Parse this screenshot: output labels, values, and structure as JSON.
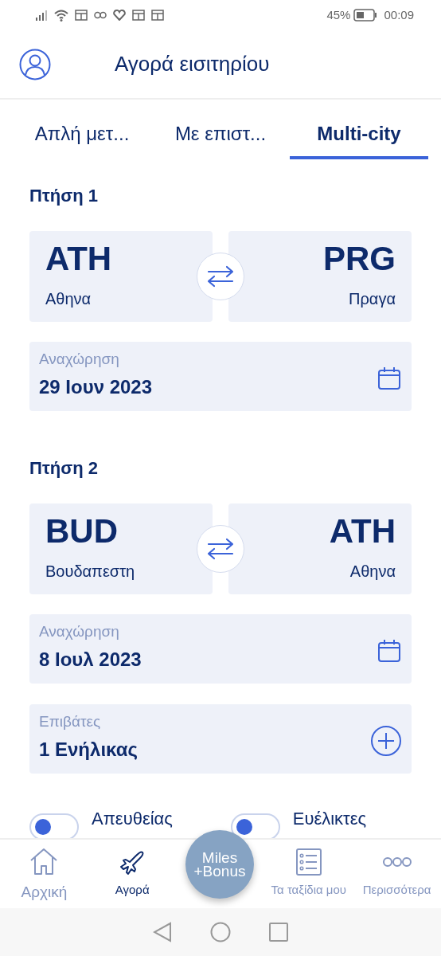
{
  "status_bar": {
    "battery": "45%",
    "time": "00:09"
  },
  "header": {
    "title": "Αγορά εισιτηρίου"
  },
  "tabs": [
    {
      "label": "Απλή μετ...",
      "selected": false
    },
    {
      "label": "Με επιστ...",
      "selected": false
    },
    {
      "label": "Multi-city",
      "selected": true
    }
  ],
  "flights": [
    {
      "title": "Πτήση 1",
      "from": {
        "code": "ATH",
        "city": "Αθηνα"
      },
      "to": {
        "code": "PRG",
        "city": "Πραγα"
      },
      "departure": {
        "label": "Αναχώρηση",
        "value": "29 Ιουν 2023"
      }
    },
    {
      "title": "Πτήση 2",
      "from": {
        "code": "BUD",
        "city": "Βουδαπεστη"
      },
      "to": {
        "code": "ATH",
        "city": "Αθηνα"
      },
      "departure": {
        "label": "Αναχώρηση",
        "value": "8 Ιουλ 2023"
      }
    }
  ],
  "passengers": {
    "label": "Επιβάτες",
    "value": "1 Ενήλικας"
  },
  "toggles": [
    {
      "label": "Απευθείας",
      "on": false
    },
    {
      "label": "Ευέλικτες",
      "on": false
    }
  ],
  "bottom_nav": [
    {
      "kind": "home",
      "label": "Αρχική",
      "selected": false
    },
    {
      "kind": "plane",
      "label": "Αγορά",
      "selected": true
    },
    {
      "kind": "logo",
      "lines": [
        "Miles",
        "+Bonus"
      ]
    },
    {
      "kind": "list",
      "label": "Τα ταξίδια μου",
      "selected": false
    },
    {
      "kind": "more",
      "label": "Περισσότερα",
      "selected": false
    }
  ]
}
